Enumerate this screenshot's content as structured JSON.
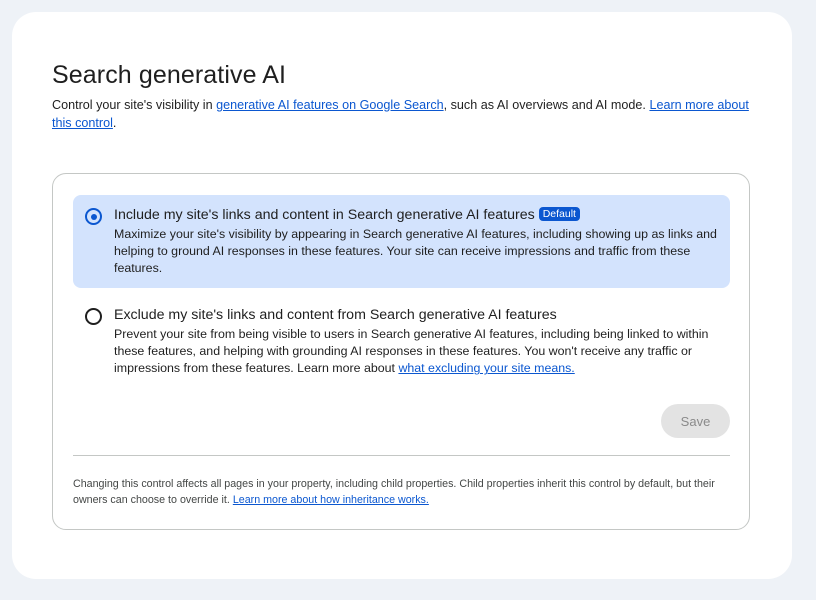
{
  "page": {
    "title": "Search generative AI",
    "description": {
      "prefix": "Control your site's visibility in ",
      "link1": "generative AI features on Google Search",
      "middle": ", such as AI overviews and AI mode. ",
      "link2": "Learn more about this control",
      "suffix": "."
    }
  },
  "options": {
    "include": {
      "title": "Include my site's links and content in Search generative AI features",
      "badge": "Default",
      "description": "Maximize your site's visibility by appearing in Search generative AI features, including showing up as links and helping to ground AI responses in these features. Your site can receive impressions and traffic from these features.",
      "selected": true
    },
    "exclude": {
      "title": "Exclude my site's links and content from Search generative AI features",
      "description_prefix": "Prevent your site from being visible to users in Search generative AI features, including being linked to within these features, and helping with grounding AI responses in these features. You won't receive any traffic or impressions from these features. Learn more about ",
      "link": "what excluding your site means.",
      "selected": false
    }
  },
  "actions": {
    "save_label": "Save",
    "save_enabled": false
  },
  "footer": {
    "text": "Changing this control affects all pages in your property, including child properties. Child properties inherit this control by default, but their owners can choose to override it. ",
    "link": "Learn more about how inheritance works."
  },
  "colors": {
    "accent": "#0b57d0",
    "selected_background": "#d3e3fd",
    "page_background": "#eef2f7",
    "disabled_button": "#e3e3e3"
  }
}
